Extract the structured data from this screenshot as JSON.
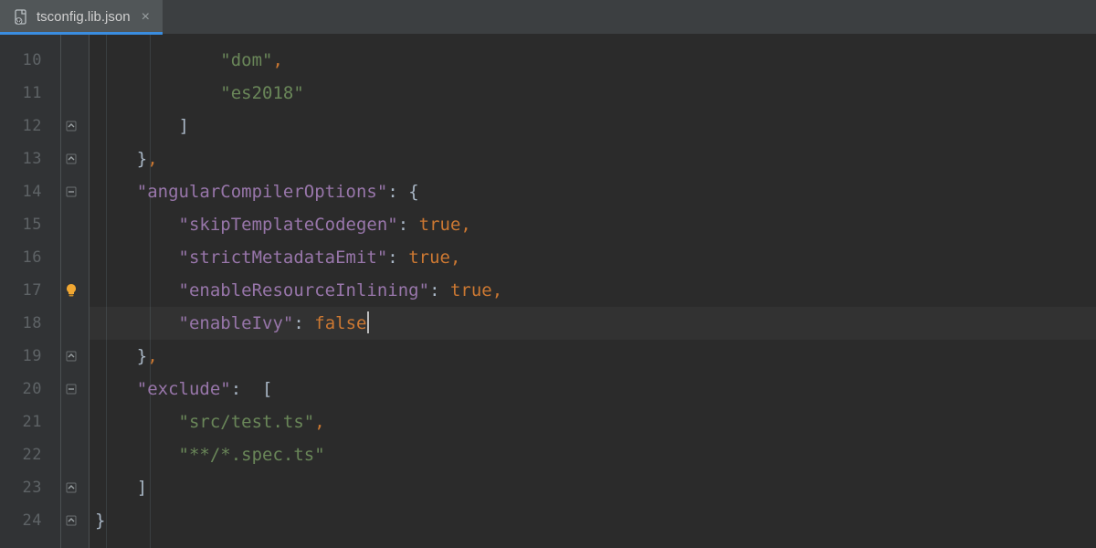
{
  "tab": {
    "filename": "tsconfig.lib.json",
    "active": true
  },
  "gutter": {
    "start": 10,
    "end": 24
  },
  "icons": {
    "bulb_row": 17,
    "fold_close_rows": [
      12,
      13,
      19,
      23,
      24
    ],
    "fold_open_rows": [
      14,
      20
    ]
  },
  "code": {
    "10": {
      "indent": 3,
      "tokens": [
        {
          "t": "str",
          "v": "\"dom\""
        },
        {
          "t": "punct",
          "v": ","
        }
      ]
    },
    "11": {
      "indent": 3,
      "tokens": [
        {
          "t": "str",
          "v": "\"es2018\""
        }
      ]
    },
    "12": {
      "indent": 2,
      "tokens": [
        {
          "t": "plain",
          "v": "]"
        }
      ]
    },
    "13": {
      "indent": 1,
      "tokens": [
        {
          "t": "plain",
          "v": "}"
        },
        {
          "t": "punct",
          "v": ","
        }
      ]
    },
    "14": {
      "indent": 1,
      "tokens": [
        {
          "t": "key",
          "v": "\"angularCompilerOptions\""
        },
        {
          "t": "plain",
          "v": ": {"
        }
      ]
    },
    "15": {
      "indent": 2,
      "tokens": [
        {
          "t": "key",
          "v": "\"skipTemplateCodegen\""
        },
        {
          "t": "plain",
          "v": ": "
        },
        {
          "t": "bool",
          "v": "true"
        },
        {
          "t": "punct",
          "v": ","
        }
      ]
    },
    "16": {
      "indent": 2,
      "tokens": [
        {
          "t": "key",
          "v": "\"strictMetadataEmit\""
        },
        {
          "t": "plain",
          "v": ": "
        },
        {
          "t": "bool",
          "v": "true"
        },
        {
          "t": "punct",
          "v": ","
        }
      ]
    },
    "17": {
      "indent": 2,
      "tokens": [
        {
          "t": "key",
          "v": "\"enableResourceInlining\""
        },
        {
          "t": "plain",
          "v": ": "
        },
        {
          "t": "bool",
          "v": "true"
        },
        {
          "t": "punct",
          "v": ","
        }
      ]
    },
    "18": {
      "indent": 2,
      "tokens": [
        {
          "t": "key",
          "v": "\"enableIvy\""
        },
        {
          "t": "plain",
          "v": ": "
        },
        {
          "t": "bool",
          "v": "false"
        }
      ],
      "caret": true,
      "current": true
    },
    "19": {
      "indent": 1,
      "tokens": [
        {
          "t": "plain",
          "v": "}"
        },
        {
          "t": "punct",
          "v": ","
        }
      ]
    },
    "20": {
      "indent": 1,
      "tokens": [
        {
          "t": "key",
          "v": "\"exclude\""
        },
        {
          "t": "plain",
          "v": ":  ["
        }
      ]
    },
    "21": {
      "indent": 2,
      "tokens": [
        {
          "t": "str",
          "v": "\"src/test.ts\""
        },
        {
          "t": "punct",
          "v": ","
        }
      ]
    },
    "22": {
      "indent": 2,
      "tokens": [
        {
          "t": "str",
          "v": "\"**/*.spec.ts\""
        }
      ]
    },
    "23": {
      "indent": 1,
      "tokens": [
        {
          "t": "plain",
          "v": "]"
        }
      ]
    },
    "24": {
      "indent": 0,
      "tokens": [
        {
          "t": "plain",
          "v": "}"
        }
      ]
    }
  },
  "colors": {
    "bg": "#2b2b2b",
    "gutter": "#313335",
    "string": "#6a8759",
    "key": "#9876aa",
    "punct": "#cc7832",
    "accent": "#3a8de0"
  }
}
